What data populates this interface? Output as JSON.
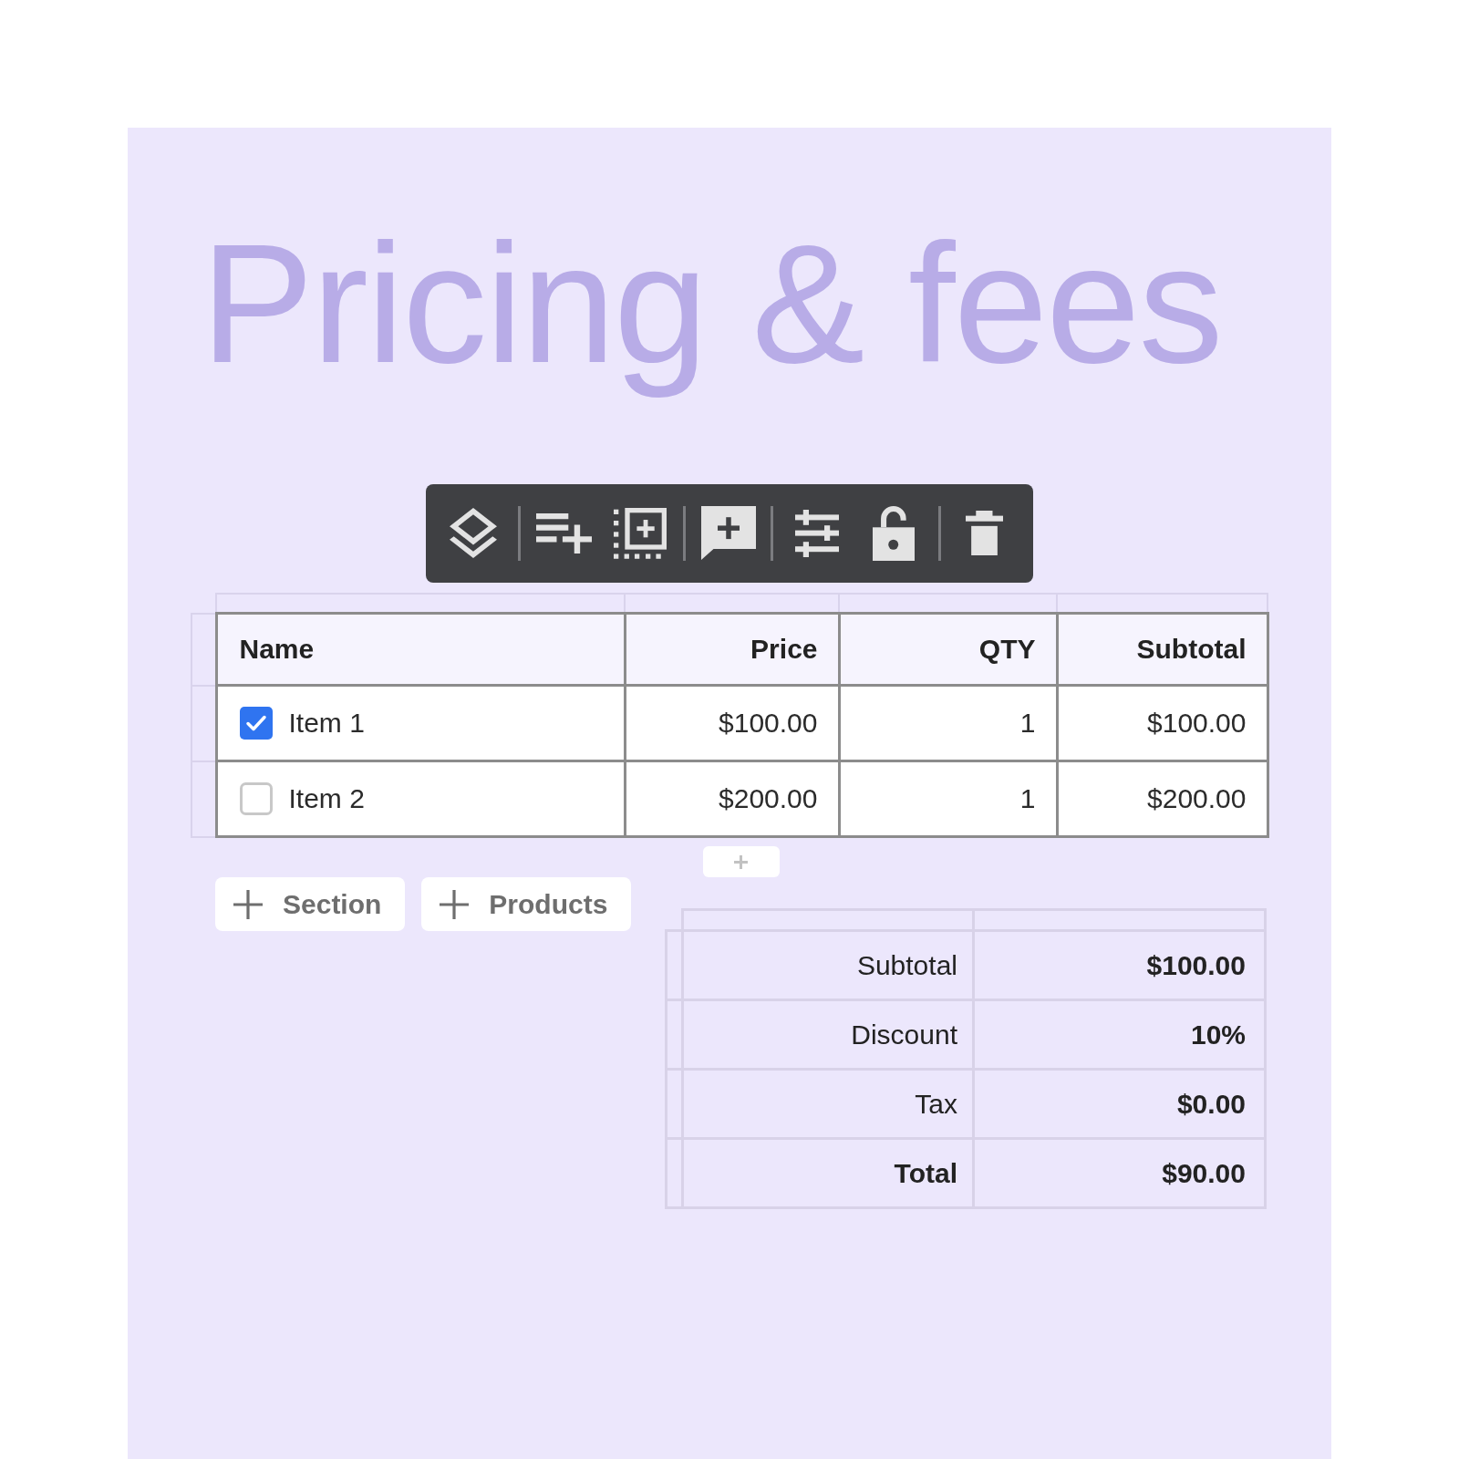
{
  "title": "Pricing & fees",
  "products_table": {
    "columns": [
      "Name",
      "Price",
      "QTY",
      "Subtotal"
    ],
    "rows": [
      {
        "checked": true,
        "name": "Item 1",
        "price": "$100.00",
        "qty": "1",
        "subtotal": "$100.00"
      },
      {
        "checked": false,
        "name": "Item 2",
        "price": "$200.00",
        "qty": "1",
        "subtotal": "$200.00"
      }
    ]
  },
  "add_buttons": [
    {
      "label": "Section"
    },
    {
      "label": "Products"
    }
  ],
  "summary": {
    "rows": [
      {
        "kind": "line",
        "label": "Subtotal",
        "value": "$100.00"
      },
      {
        "kind": "line",
        "label": "Discount",
        "value": "10%"
      },
      {
        "kind": "line",
        "label": "Tax",
        "value": "$0.00"
      },
      {
        "kind": "total",
        "label": "Total",
        "value": "$90.00"
      }
    ]
  }
}
